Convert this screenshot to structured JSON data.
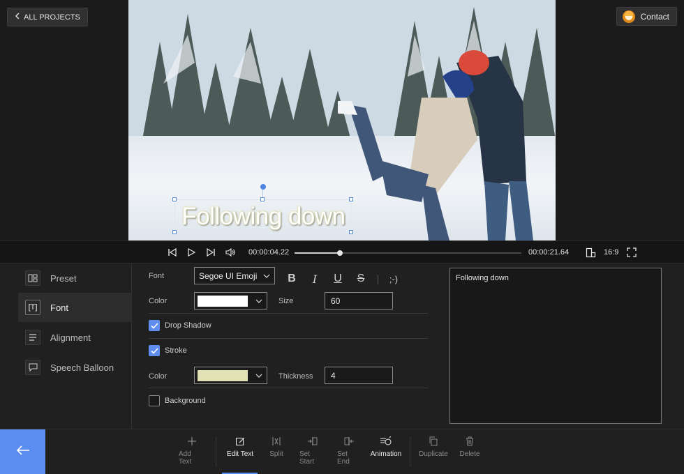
{
  "header": {
    "back_label": "ALL PROJECTS",
    "contact_label": "Contact"
  },
  "preview": {
    "caption": "Following down"
  },
  "playback": {
    "current_time": "00:00:04.22",
    "total_time": "00:00:21.64",
    "progress": 0.2,
    "aspect_ratio": "16:9"
  },
  "sidebar": {
    "items": [
      {
        "label": "Preset",
        "icon": "layout-icon"
      },
      {
        "label": "Font",
        "icon": "text-frame-icon"
      },
      {
        "label": "Alignment",
        "icon": "align-icon"
      },
      {
        "label": "Speech Balloon",
        "icon": "speech-balloon-icon"
      }
    ],
    "active": "Font"
  },
  "font_panel": {
    "font_label": "Font",
    "font_value": "Segoe UI Emoji",
    "color_label": "Color",
    "color_value": "#ffffff",
    "size_label": "Size",
    "size_value": "60",
    "drop_shadow_label": "Drop Shadow",
    "drop_shadow_checked": true,
    "stroke_label": "Stroke",
    "stroke_checked": true,
    "stroke_color_label": "Color",
    "stroke_color_value": "#e2e2b6",
    "thickness_label": "Thickness",
    "thickness_value": "4",
    "background_label": "Background",
    "background_checked": false,
    "format_buttons": [
      "B",
      "I",
      "U",
      "S",
      ";-)"
    ]
  },
  "text_editor": {
    "value": "Following down"
  },
  "toolbar": {
    "tools": [
      {
        "label": "Add Text",
        "icon": "plus-icon"
      },
      {
        "label": "Edit Text",
        "icon": "edit-icon"
      },
      {
        "label": "Split",
        "icon": "split-icon"
      },
      {
        "label": "Set Start",
        "icon": "set-start-icon"
      },
      {
        "label": "Set End",
        "icon": "set-end-icon"
      },
      {
        "label": "Animation",
        "icon": "animation-icon"
      },
      {
        "label": "Duplicate",
        "icon": "duplicate-icon"
      },
      {
        "label": "Delete",
        "icon": "delete-icon"
      }
    ],
    "active": "Edit Text"
  },
  "colors": {
    "accent": "#5b8df0"
  }
}
